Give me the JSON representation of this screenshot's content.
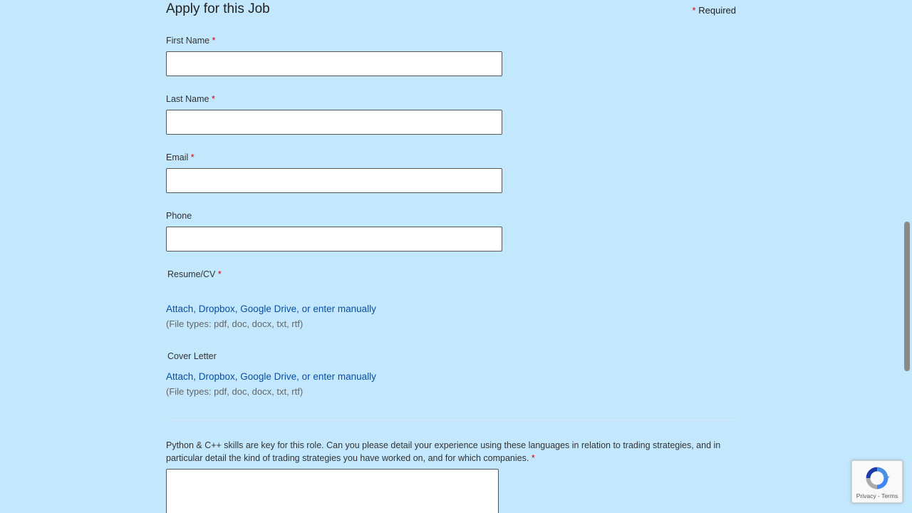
{
  "form": {
    "title": "Apply for this Job",
    "required_star": "*",
    "required_note": "Required",
    "fields": {
      "first_name": {
        "label": "First Name",
        "star": "*",
        "value": ""
      },
      "last_name": {
        "label": "Last Name",
        "star": "*",
        "value": ""
      },
      "email": {
        "label": "Email",
        "star": "*",
        "value": ""
      },
      "phone": {
        "label": "Phone",
        "value": ""
      }
    },
    "resume": {
      "label": "Resume/CV",
      "star": "*",
      "attach_link": "Attach, Dropbox, Google Drive, or enter manually",
      "file_types": "(File types: pdf, doc, docx, txt, rtf)"
    },
    "cover_letter": {
      "label": "Cover Letter",
      "attach_link": "Attach, Dropbox, Google Drive, or enter manually",
      "file_types": "(File types: pdf, doc, docx, txt, rtf)"
    },
    "question": {
      "text": "Python & C++ skills are key for this role. Can you please detail your experience using these languages in relation to trading strategies, and in particular detail the kind of trading strategies you have worked on, and for which companies.",
      "star": "*",
      "value": ""
    }
  },
  "recaptcha": {
    "privacy": "Privacy",
    "separator": " - ",
    "terms": "Terms",
    "icon": "recaptcha-logo"
  },
  "colors": {
    "background": "#c3e7fc",
    "link": "#0a4fa4",
    "required_star": "#d0021b"
  }
}
